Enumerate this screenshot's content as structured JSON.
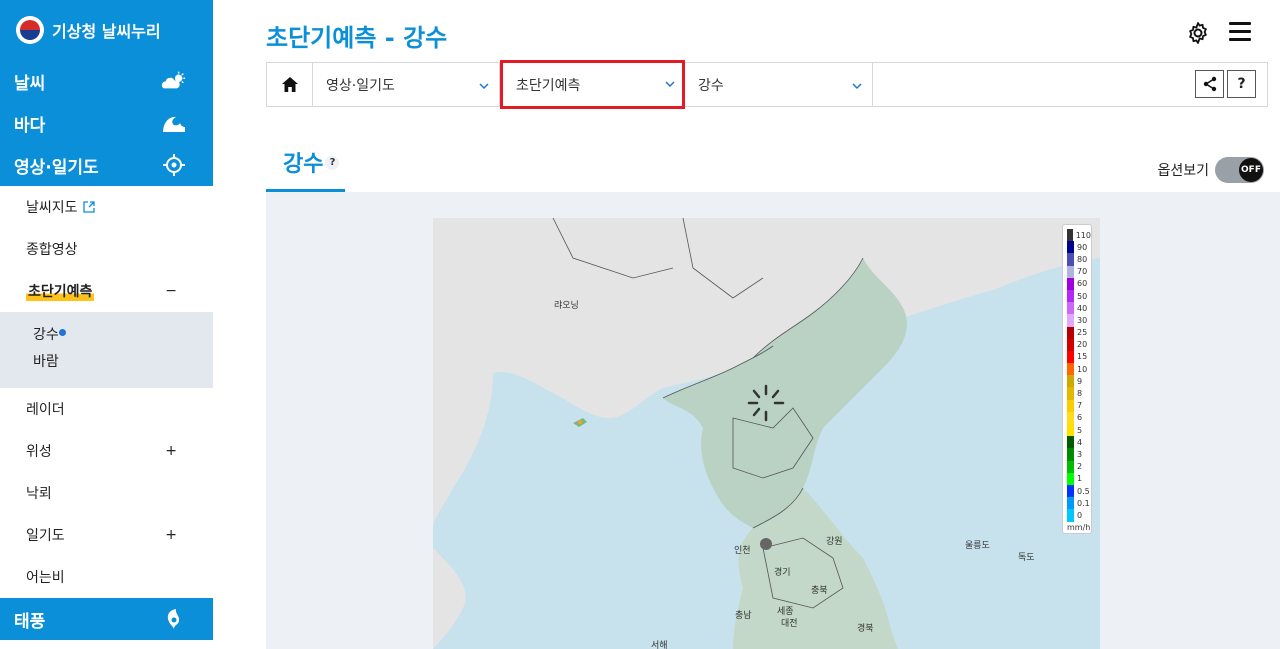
{
  "sidebar": {
    "logo_text": "기상청 날씨누리",
    "categories": [
      {
        "label": "날씨",
        "icon": "weather-cloud-sun-icon"
      },
      {
        "label": "바다",
        "icon": "wave-icon"
      },
      {
        "label": "영상·일기도",
        "icon": "satellite-target-icon"
      }
    ],
    "sub_items": [
      {
        "label": "날씨지도",
        "icon": "external-link-icon"
      },
      {
        "label": "종합영상"
      },
      {
        "label": "초단기예측",
        "marker": "−"
      },
      {
        "label": "레이더"
      },
      {
        "label": "위성",
        "marker": "+"
      },
      {
        "label": "낙뢰"
      },
      {
        "label": "일기도",
        "marker": "+"
      },
      {
        "label": "어는비"
      }
    ],
    "subsub_items": [
      "강수",
      "바람"
    ],
    "typhoon": {
      "label": "태풍",
      "icon": "typhoon-icon"
    }
  },
  "header": {
    "title": "초단기예측 - 강수",
    "icons": [
      "gear-icon",
      "menu-icon"
    ]
  },
  "navbar": {
    "home_icon": "home-icon",
    "dropdown1": "영상·일기도",
    "dropdown2": "초단기예측",
    "dropdown3": "강수",
    "share_icon": "share-icon",
    "help_label": "?"
  },
  "tab": {
    "label": "강수",
    "help": "?",
    "options_label": "옵션보기",
    "toggle_state": "OFF"
  },
  "legend": {
    "values": [
      "110",
      "90",
      "80",
      "70",
      "60",
      "50",
      "40",
      "30",
      "25",
      "20",
      "15",
      "10",
      "9",
      "8",
      "7",
      "6",
      "5",
      "4",
      "3",
      "2",
      "1",
      "0.5",
      "0.1",
      "0"
    ],
    "colors": [
      "#333333",
      "#000390",
      "#4c4eb1",
      "#b3b4de",
      "#9f00e0",
      "#b429f9",
      "#ca6afa",
      "#e0a9fc",
      "#b40000",
      "#d20000",
      "#ff0000",
      "#ff6600",
      "#ccaa00",
      "#e0b900",
      "#f9cd00",
      "#ffdc1f",
      "#ffe100",
      "#005a00",
      "#008c00",
      "#00be00",
      "#00ff00",
      "#0033ff",
      "#009bf5",
      "#00c8ff"
    ],
    "unit": "mm/h"
  },
  "map_labels": {
    "liaoning": "랴오닝",
    "gangwon": "강원",
    "ulleungdo": "울릉도",
    "dokdo": "독도",
    "gyeonggi": "경기",
    "chungbuk": "충북",
    "chungnam": "충남",
    "sejong": "세종",
    "daejeon": "대전",
    "gyeongbuk": "경북",
    "seohae": "서해",
    "incheon": "인천"
  }
}
